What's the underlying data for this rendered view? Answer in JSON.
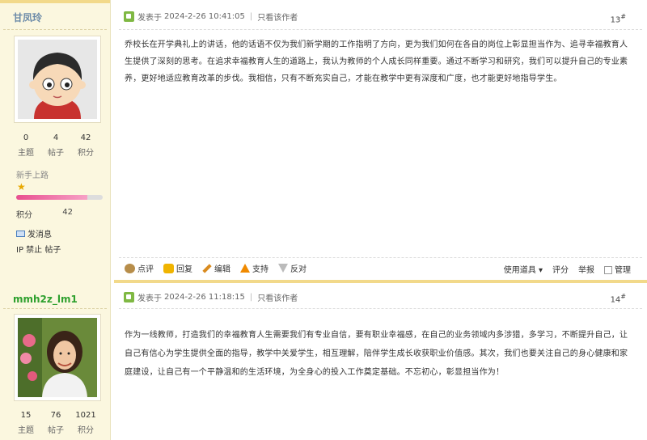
{
  "posts": [
    {
      "username": "甘凤玲",
      "stats": [
        {
          "value": "0",
          "label": "主题"
        },
        {
          "value": "4",
          "label": "帖子"
        },
        {
          "value": "42",
          "label": "积分"
        }
      ],
      "rank": "新手上路",
      "rank_progress": 0.82,
      "credit_label": "积分",
      "credit_value": "42",
      "send_message": "发消息",
      "ip_line": "IP 禁止 帖子",
      "post_label": "发表于",
      "post_time": "2024-2-26 10:41:05",
      "author_only": "只看该作者",
      "floor_num": "13",
      "floor_sup": "#",
      "content": "乔校长在开学典礼上的讲话，他的话语不仅为我们新学期的工作指明了方向，更为我们如何在各自的岗位上彰显担当作为、追寻幸福教育人生提供了深刻的思考。在追求幸福教育人生的道路上，我认为教师的个人成长同样重要。通过不断学习和研究，我们可以提升自己的专业素养，更好地适应教育改革的步伐。我相信，只有不断充实自己，才能在教学中更有深度和广度，也才能更好地指导学生。",
      "actions": [
        "点评",
        "回复",
        "编辑",
        "支持",
        "反对"
      ],
      "right_actions": {
        "tools": "使用道具",
        "rate": "评分",
        "report": "举报",
        "manage": "管理"
      }
    },
    {
      "username": "mmh2z_lm1",
      "stats": [
        {
          "value": "15",
          "label": "主题"
        },
        {
          "value": "76",
          "label": "帖子"
        },
        {
          "value": "1021",
          "label": "积分"
        }
      ],
      "post_label": "发表于",
      "post_time": "2024-2-26 11:18:15",
      "author_only": "只看该作者",
      "floor_num": "14",
      "floor_sup": "#",
      "content": "作为一线教师，打造我们的幸福教育人生需要我们有专业自信，要有职业幸福感，在自己的业务领域内多涉猎，多学习，不断提升自己，让自己有信心为学生提供全面的指导，教学中关爱学生，相互理解，陪伴学生成长收获职业价值感。其次，我们也要关注自己的身心健康和家庭建设，让自己有一个平静温和的生活环境，为全身心的投入工作奠定基础。不忘初心，彰显担当作为！"
    }
  ],
  "colors": {
    "sidebar_bg": "#fbf7df",
    "accent": "#f2d98a",
    "username1": "#6b8aa8",
    "username2": "#2ea02e"
  },
  "icons": [
    "post-icon",
    "comment-icon",
    "reply-icon",
    "edit-icon",
    "thumbs-up-icon",
    "thumbs-down-icon",
    "mail-icon",
    "star-icon"
  ]
}
